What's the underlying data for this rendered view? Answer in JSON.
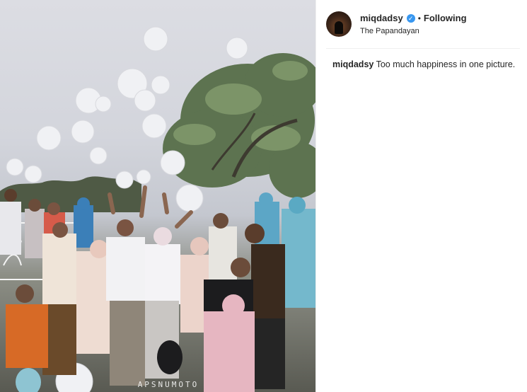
{
  "post": {
    "image_alt": "Group of people releasing white balloons under a tree",
    "watermark": "APSNUMOTO",
    "author": {
      "username": "miqdadsy",
      "verified_icon": "verified-badge-icon",
      "separator": "•",
      "follow_status": "Following",
      "location": "The Papandayan"
    },
    "caption": {
      "username": "miqdadsy",
      "text": "Too much happiness in one picture."
    }
  },
  "colors": {
    "verified_blue": "#3897f0",
    "divider": "#efefef",
    "text": "#262626"
  }
}
